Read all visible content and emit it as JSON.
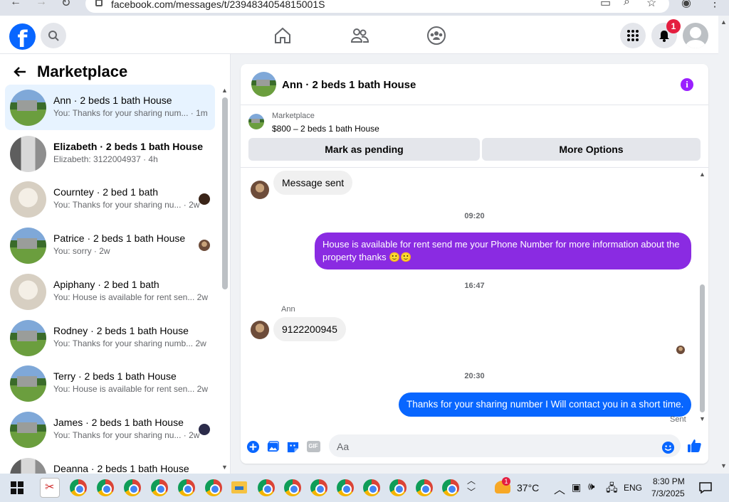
{
  "browser": {
    "url": "facebook.com/messages/t/2394834054815001S"
  },
  "topbar": {
    "notification_count": "1"
  },
  "sidebar": {
    "title": "Marketplace",
    "conversations": [
      {
        "name": "Ann · 2 beds 1 bath House",
        "preview": "You: Thanks for your sharing num... · 1m",
        "thumb": "house",
        "active": true
      },
      {
        "name": "Elizabeth · 2 beds 1 bath House",
        "preview": "Elizabeth: 3122004937 · 4h",
        "thumb": "room-dark"
      },
      {
        "name": "Courntey · 2 bed 1 bath",
        "preview": "You: Thanks for your sharing nu... · 2w",
        "thumb": "room"
      },
      {
        "name": "Patrice · 2 beds 1 bath House",
        "preview": "You: sorry · 2w",
        "thumb": "house"
      },
      {
        "name": "Apiphany · 2 bed 1 bath",
        "preview": "You: House is available for rent sen... 2w",
        "thumb": "room"
      },
      {
        "name": "Rodney · 2 beds 1 bath House",
        "preview": "You: Thanks for your sharing numb... 2w",
        "thumb": "house"
      },
      {
        "name": "Terry · 2 beds 1 bath House",
        "preview": "You: House is available for rent sen... 2w",
        "thumb": "house"
      },
      {
        "name": "James · 2 beds 1 bath House",
        "preview": "You: Thanks for your sharing nu... · 2w",
        "thumb": "house"
      },
      {
        "name": "Deanna · 2 beds 1 bath House",
        "preview": "",
        "thumb": "room-dark"
      }
    ]
  },
  "chat": {
    "title": "Ann · 2 beds 1 bath House",
    "marketplace_label": "Marketplace",
    "listing": "$800 – 2 beds 1 bath House",
    "mark_pending_label": "Mark as pending",
    "more_options_label": "More Options",
    "messages": {
      "msg1": "Message sent",
      "time1": "09:20",
      "msg2": "House is available for rent send me your Phone Number for more information about the property thanks 🙂🙂",
      "time2": "16:47",
      "sender": "Ann",
      "msg3": "9122200945",
      "time3": "20:30",
      "msg4": "Thanks for your sharing number I Will contact you in a short time.",
      "status": "Sent"
    },
    "composer_placeholder": "Aa",
    "gif_label": "GIF"
  },
  "colors": {
    "brand": "#0866ff",
    "purple_bubble": "#8a2be2",
    "blue_bubble": "#0866ff",
    "info": "#9a1fff"
  },
  "taskbar": {
    "weather": "37°C",
    "lang": "ENG",
    "time": "8:30 PM",
    "date": "7/3/2025",
    "badge": "1"
  }
}
